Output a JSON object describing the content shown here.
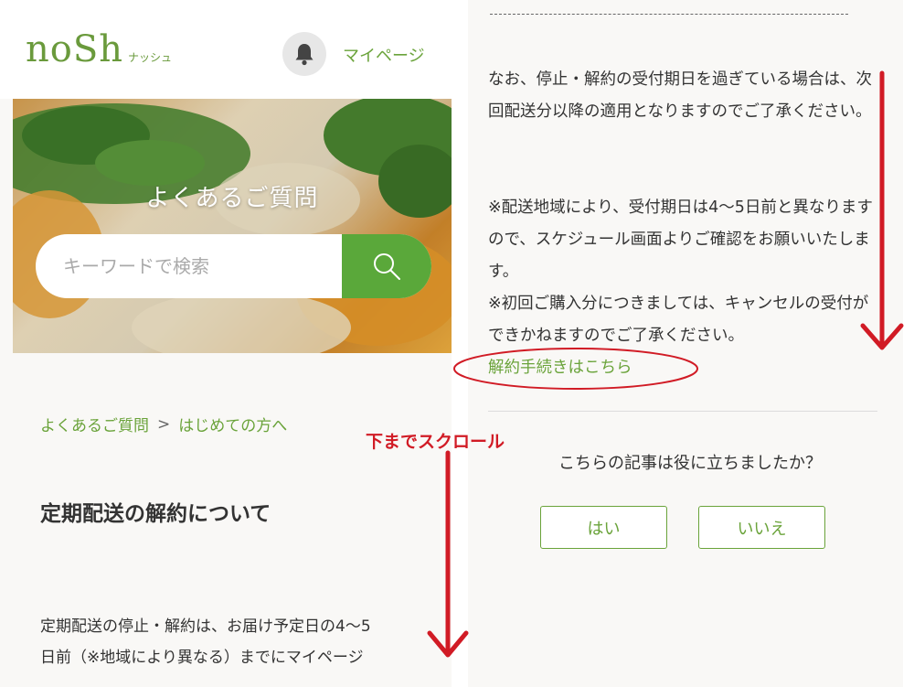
{
  "header": {
    "logo_main": "noSh",
    "logo_sub": "ナッシュ",
    "bell_icon": "bell-icon",
    "mypage_label": "マイページ"
  },
  "hero": {
    "title": "よくあるご質問",
    "search_placeholder": "キーワードで検索",
    "search_icon": "search-icon"
  },
  "breadcrumb": {
    "items": [
      "よくあるご質問",
      "はじめての方へ"
    ],
    "separator": ">"
  },
  "article": {
    "title": "定期配送の解約について",
    "intro_line1": "定期配送の停止・解約は、お届け予定日の4〜5",
    "intro_line2": "日前（※地域により異なる）までにマイページ"
  },
  "right": {
    "para1": "なお、停止・解約の受付期日を過ぎている場合は、次回配送分以降の適用となりますのでご了承ください。",
    "para2": "※配送地域により、受付期日は4〜5日前と異なりますので、スケジュール画面よりご確認をお願いいたします。",
    "para3": "※初回ご購入分につきましては、キャンセルの受付ができかねますのでご了承ください。",
    "cancel_link": "解約手続きはこちら",
    "feedback_question": "こちらの記事は役に立ちましたか？",
    "yes_label": "はい",
    "no_label": "いいえ"
  },
  "annotation": {
    "scroll_label": "下までスクロール",
    "color": "#d11b25"
  },
  "colors": {
    "brand_green": "#6aa33a",
    "search_button": "#5aa83a",
    "annotation_red": "#d11b25"
  }
}
